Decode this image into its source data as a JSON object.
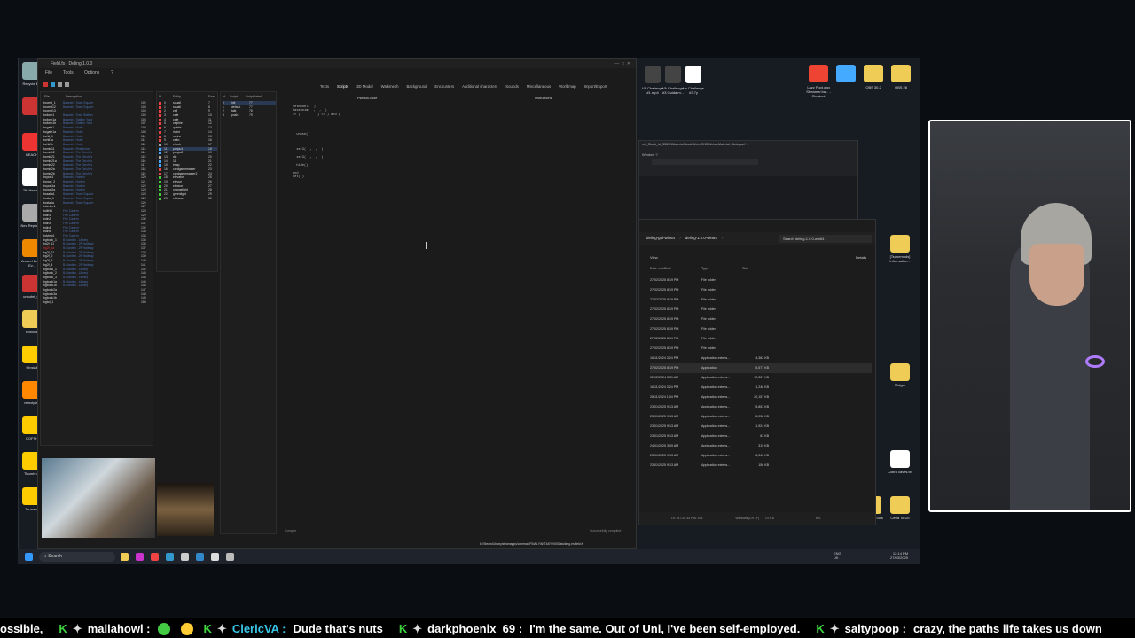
{
  "editor": {
    "title": "Field.fs - Deling 1.0.0",
    "menu": [
      "File",
      "Tools",
      "Options",
      "?"
    ],
    "tabs": [
      "Texts",
      "Scripts",
      "3D Model",
      "Walkmesh",
      "Background",
      "Encounters",
      "Additional characters",
      "Sounds",
      "Miscellaneous",
      "Worldmap",
      "Import/Export"
    ],
    "field_header": {
      "file": "File",
      "desc": "Description"
    },
    "fields": [
      [
        "bccent_1",
        "Balamb - Town Square",
        "102"
      ],
      [
        "bccent12",
        "Balamb - Town Square",
        "103"
      ],
      [
        "bccent13",
        "",
        "104"
      ],
      [
        "bcform1",
        "Balamb - Train Station",
        "105"
      ],
      [
        "bcform1a",
        "Balamb - Station Yard",
        "106"
      ],
      [
        "bcform1b",
        "Balamb - Station Yard",
        "107"
      ],
      [
        "bcgate1",
        "Balamb - Hotel",
        "108"
      ],
      [
        "bcgate1a",
        "Balamb - Hotel",
        "109"
      ],
      [
        "bchtl_1",
        "Balamb - Hotel",
        "110"
      ],
      [
        "bchtl1a",
        "Balamb - Hotel",
        "111"
      ],
      [
        "bchtl1b",
        "Balamb - Hotel",
        "112"
      ],
      [
        "bcmin11",
        "Balamb - Residence",
        "113"
      ],
      [
        "bcmin12",
        "Balamb - The Dincht's",
        "114"
      ],
      [
        "bcmin21",
        "Balamb - The Dincht's",
        "115"
      ],
      [
        "bcmin21a",
        "Balamb - The Dincht's",
        "116"
      ],
      [
        "bcmin22",
        "Balamb - The Dincht's",
        "117"
      ],
      [
        "bcmin2a",
        "Balamb - The Dincht's",
        "118"
      ],
      [
        "bcmin2b",
        "Balamb - The Dincht's",
        "119"
      ],
      [
        "bcport1",
        "Balamb - Harbor",
        "120"
      ],
      [
        "bcport_2",
        "Balamb - Harbor",
        "121"
      ],
      [
        "bcport1a",
        "Balamb - Harbor",
        "122"
      ],
      [
        "bcport2a",
        "Balamb - Harbor",
        "123"
      ],
      [
        "bcsaka1",
        "Balamb - Town Square",
        "124"
      ],
      [
        "bcsta_1",
        "Balamb - Town Square",
        "125"
      ],
      [
        "bcsta1a",
        "Balamb - Town Square",
        "126"
      ],
      [
        "bdenter1",
        "",
        "127"
      ],
      [
        "bdifrit1",
        "Fire Cavern",
        "128"
      ],
      [
        "bdin1",
        "Fire Cavern",
        "129"
      ],
      [
        "bdin2",
        "Fire Cavern",
        "130"
      ],
      [
        "bdin3",
        "Fire Cavern",
        "131"
      ],
      [
        "bdin4",
        "Fire Cavern",
        "132"
      ],
      [
        "bdin5",
        "Fire Cavern",
        "133"
      ],
      [
        "bdview1",
        "Fire Cavern",
        "134"
      ],
      [
        "bgbook_1",
        "B-Garden - Library",
        "135"
      ],
      [
        "bg2f_11",
        "B-Garden - 2F Hallway",
        "136"
      ],
      [
        "bg2f_1a",
        "B-Garden - 2F Hallway",
        "137"
      ],
      [
        "bg2f_21",
        "B-Garden - 2F Hallway",
        "138"
      ],
      [
        "bg2f_2",
        "B-Garden - 2F Hallway",
        "139"
      ],
      [
        "bg2f_3",
        "B-Garden - 2F Hallway",
        "140"
      ],
      [
        "bg2f_4",
        "B-Garden - 2F Hallway",
        "141"
      ],
      [
        "bgbook_1",
        "B-Garden - Library",
        "142"
      ],
      [
        "bgbook_2",
        "B-Garden - Library",
        "143"
      ],
      [
        "bgbook_3",
        "B-Garden - Library",
        "144"
      ],
      [
        "bgbook1a",
        "B-Garden - Library",
        "145"
      ],
      [
        "bgbook1b",
        "B-Garden - Library",
        "146"
      ],
      [
        "bgbook2a",
        "",
        "147"
      ],
      [
        "bgbook3a",
        "",
        "148"
      ],
      [
        "bgbook1b",
        "",
        "149"
      ],
      [
        "bgbd_1",
        "",
        "150"
      ]
    ],
    "entity_header": {
      "id": "Id",
      "entity": "Entity",
      "exec": "Exec",
      "id2": "Id",
      "script": "Script",
      "label": "Script label"
    },
    "entities": [
      [
        "0",
        "squall",
        "7"
      ],
      [
        "1",
        "squall",
        "8"
      ],
      [
        "2",
        "zell",
        "9"
      ],
      [
        "3",
        "cafe",
        "10"
      ],
      [
        "4",
        "cafe",
        "11"
      ],
      [
        "5",
        "celphie",
        "12"
      ],
      [
        "6",
        "quistis",
        "13"
      ],
      [
        "7",
        "irvine",
        "14"
      ],
      [
        "8",
        "ruvine",
        "15"
      ],
      [
        "9",
        "cetto",
        "16"
      ],
      [
        "10",
        "check",
        "17"
      ],
      [
        "11",
        "ponpu1",
        "18"
      ],
      [
        "12",
        "ponpu2",
        "19"
      ],
      [
        "13",
        "dic",
        "20"
      ],
      [
        "14",
        "11",
        "21"
      ],
      [
        "15",
        "tmap",
        "22"
      ],
      [
        "16",
        "cardgamemaster",
        "23"
      ],
      [
        "17",
        "cardgamemaster2",
        "24"
      ],
      [
        "18",
        "elevator",
        "25"
      ],
      [
        "19",
        "elevue",
        "26"
      ],
      [
        "20",
        "eledoor",
        "27"
      ],
      [
        "21",
        "orangelight",
        "28"
      ],
      [
        "22",
        "greenlight",
        "29"
      ],
      [
        "23",
        "elebase",
        "30"
      ]
    ],
    "scripts": [
      [
        "0",
        "init",
        "77"
      ],
      [
        "1",
        "default",
        "77"
      ],
      [
        "2",
        "talk",
        "78"
      ],
      [
        "3",
        "push",
        "79"
      ]
    ],
    "code_header": "Pseudo-code",
    "code_header2": "Instructions",
    "code": "setmodel(  )\nbaseanim(  ,  ,  )\nif (         ) == ) and (\n  \n  \n    \n    \n  unuse()\n  \n  \n    \n  set3(  ,  ,  )\n  \n  set3(  ,  ,  )\n  \n  hide()\n  \nend\nret( )",
    "compile_label": "Compile",
    "status_ok": "Successfully compiled",
    "path": "D:/Steam/Library/steamapps/common/FINAL FANTASY VIII/Data/lang-en/field.fs"
  },
  "desktop_icons": [
    {
      "label": "Recycle Bin",
      "color": "#8aa"
    },
    {
      "label": "",
      "color": "#c33"
    },
    {
      "label": "BEACH",
      "color": "#e33"
    },
    {
      "label": "7th Heaven",
      "color": "#fff"
    },
    {
      "label": "Nec Replicant",
      "color": "#aaa"
    },
    {
      "label": "Amarel Battle Ev...",
      "color": "#e80"
    },
    {
      "label": "umodel_64",
      "color": "#c33"
    },
    {
      "label": "FMtoolb",
      "color": "#ec5"
    },
    {
      "label": "Hinstall",
      "color": "#fc0"
    },
    {
      "label": "remotplay",
      "color": "#f80"
    },
    {
      "label": "KOFTH",
      "color": "#fc0"
    },
    {
      "label": "Thumbn...",
      "color": "#fc0"
    },
    {
      "label": "Tsunami",
      "color": "#fc0"
    }
  ],
  "top_icons": [
    {
      "label": "VA Challenge #1.mp4",
      "color": "#444"
    },
    {
      "label": "VA Challenge #3 Guida.m...",
      "color": "#444"
    },
    {
      "label": "Va Challenge #3.7y",
      "color": "#fff"
    }
  ],
  "top_right_icons": [
    {
      "label": "Lazy Foot.ogg Streamer.ba... - Shortcut",
      "color": "#e43"
    },
    {
      "label": "",
      "color": "#4af"
    },
    {
      "label": "OBS 30.2",
      "color": "#ec5"
    },
    {
      "label": "OBS 28",
      "color": "#ec5"
    }
  ],
  "right_icons": [
    {
      "label": "[Tsunemods] Information...",
      "color": "#ec5"
    },
    {
      "label": "Midger",
      "color": "#ec5"
    },
    {
      "label": "Coltra caves.txt",
      "color": "#fff"
    },
    {
      "label": "Modding Tools",
      "color": "#ec5"
    },
    {
      "label": "Cetra To Do",
      "color": "#ec5"
    }
  ],
  "notepad": {
    "title": "mit_Stock_lvl_3360f1Materia\\Stock\\WeirdSHD\\Weiss-Material - Notepad++",
    "menu": "Window  ?"
  },
  "explorer": {
    "breadcrumb": [
      "deling-gui-win64",
      "deling-1.0.0-win64"
    ],
    "search": "Search deling-1.0.0-win64",
    "view": "View",
    "details": "Details",
    "cols": [
      "Date modified",
      "Type",
      "Size"
    ],
    "rows": [
      [
        "27/02/2025 8:19 PM",
        "File folder",
        ""
      ],
      [
        "27/02/2025 8:19 PM",
        "File folder",
        ""
      ],
      [
        "27/02/2025 8:19 PM",
        "File folder",
        ""
      ],
      [
        "27/02/2025 8:19 PM",
        "File folder",
        ""
      ],
      [
        "27/02/2025 8:19 PM",
        "File folder",
        ""
      ],
      [
        "27/02/2025 8:19 PM",
        "File folder",
        ""
      ],
      [
        "27/02/2025 8:19 PM",
        "File folder",
        ""
      ],
      [
        "27/02/2025 8:19 PM",
        "File folder",
        ""
      ],
      [
        "16/11/2024 3:24 PM",
        "Application extens...",
        "4,382 KB"
      ],
      [
        "27/02/2025 8:19 PM",
        "Application",
        "5,577 KB"
      ],
      [
        "02/12/2024 3:31 AM",
        "Application extens...",
        "12,307 KB"
      ],
      [
        "16/11/2024 3:24 PM",
        "Application extens...",
        "1,248 KB"
      ],
      [
        "28/11/2024 1:04 PM",
        "Application extens...",
        "20,157 KB"
      ],
      [
        "23/01/2025 9:13 AM",
        "Application extens...",
        "5,853 KB"
      ],
      [
        "23/01/2025 9:13 AM",
        "Application extens...",
        "8,038 KB"
      ],
      [
        "23/01/2025 9:13 AM",
        "Application extens...",
        "1,924 KB"
      ],
      [
        "23/01/2025 9:13 AM",
        "Application extens...",
        "63 KB"
      ],
      [
        "24/01/2025 3:09 AM",
        "Application extens...",
        "315 KB"
      ],
      [
        "23/01/2025 9:13 AM",
        "Application extens...",
        "6,343 KB"
      ],
      [
        "23/01/2025 9:13 AM",
        "Application extens...",
        "158 KB"
      ]
    ],
    "status": "Ln: 24  Col: 44  Pos: 535",
    "eol": "Windows (CR LF)",
    "enc": "UTF-8",
    "ins": "INS"
  },
  "taskbar": {
    "search": "Search",
    "lang1": "ENG",
    "lang2": "UK",
    "time": "12:14 PM",
    "date": "27/03/2025"
  },
  "ticker": [
    {
      "name": "",
      "text": "ossible,"
    },
    {
      "name": "mallahowl :",
      "text": ""
    },
    {
      "name": "ClericVA :",
      "text": "Dude that's nuts"
    },
    {
      "name": "darkphoenix_69 :",
      "text": "I'm the same. Out of Uni, I've been self-employed."
    },
    {
      "name": "saltypoop :",
      "text": "crazy, the paths life takes us down"
    }
  ]
}
